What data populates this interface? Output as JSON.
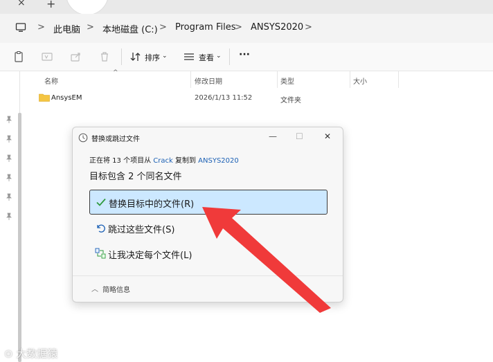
{
  "tabs": {
    "close_glyph": "×",
    "new_glyph": "+"
  },
  "address": {
    "crumbs": [
      "此电脑",
      "本地磁盘 (C:)",
      "Program Files",
      "ANSYS2020"
    ],
    "separator": ">"
  },
  "toolbar": {
    "sort_label": "排序",
    "view_label": "查看",
    "more_glyph": "···"
  },
  "columns": {
    "name": "名称",
    "modified": "修改日期",
    "type": "类型",
    "size": "大小"
  },
  "files": [
    {
      "name": "AnsysEM",
      "modified": "2026/1/13 11:52",
      "type": "文件夹",
      "size": ""
    }
  ],
  "dialog": {
    "title": "替换或跳过文件",
    "status_prefix": "正在将 13 个项目从",
    "status_source": "Crack",
    "status_mid": "复制到",
    "status_dest": "ANSYS2020",
    "heading": "目标包含 2 个同名文件",
    "option_replace": "替换目标中的文件(R)",
    "option_skip": "跳过这些文件(S)",
    "option_decide": "让我决定每个文件(L)",
    "details_label": "简略信息",
    "minimize_glyph": "—",
    "maximize_glyph": "☐",
    "close_glyph": "✕"
  },
  "watermark": "大数据猿",
  "colors": {
    "accent": "#1a5fb4",
    "selected_bg": "#cce8ff",
    "arrow": "#f03a3a",
    "folder": "#f4c542"
  }
}
